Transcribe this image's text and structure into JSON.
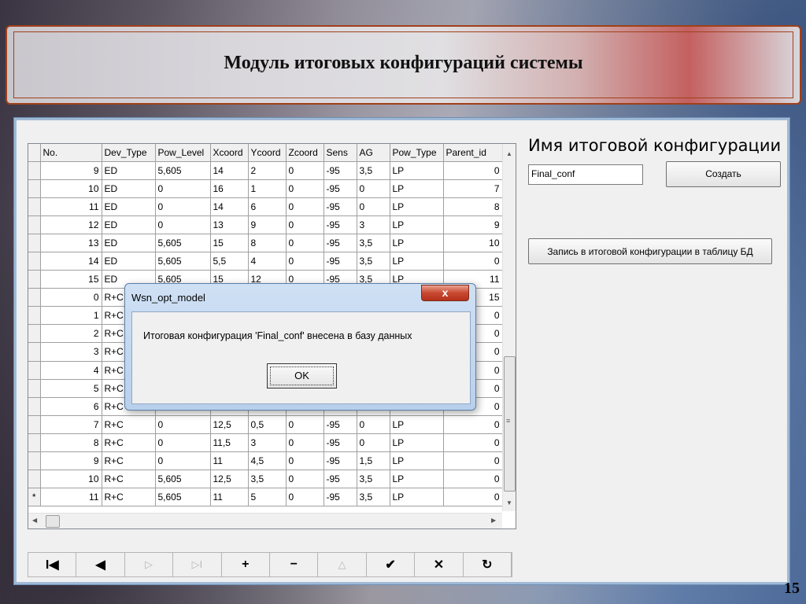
{
  "slide": {
    "title": "Модуль итоговых конфигураций системы",
    "page_number": "15"
  },
  "grid": {
    "columns": [
      "No.",
      "Dev_Type",
      "Pow_Level",
      "Xcoord",
      "Ycoord",
      "Zcoord",
      "Sens",
      "AG",
      "Pow_Type",
      "Parent_id"
    ],
    "rows": [
      {
        "ind": "",
        "no": "9",
        "dev": "ED",
        "pow": "5,605",
        "x": "14",
        "y": "2",
        "z": "0",
        "sens": "-95",
        "ag": "3,5",
        "ptype": "LP",
        "parent": "0"
      },
      {
        "ind": "",
        "no": "10",
        "dev": "ED",
        "pow": "0",
        "x": "16",
        "y": "1",
        "z": "0",
        "sens": "-95",
        "ag": "0",
        "ptype": "LP",
        "parent": "7"
      },
      {
        "ind": "",
        "no": "11",
        "dev": "ED",
        "pow": "0",
        "x": "14",
        "y": "6",
        "z": "0",
        "sens": "-95",
        "ag": "0",
        "ptype": "LP",
        "parent": "8"
      },
      {
        "ind": "",
        "no": "12",
        "dev": "ED",
        "pow": "0",
        "x": "13",
        "y": "9",
        "z": "0",
        "sens": "-95",
        "ag": "3",
        "ptype": "LP",
        "parent": "9"
      },
      {
        "ind": "",
        "no": "13",
        "dev": "ED",
        "pow": "5,605",
        "x": "15",
        "y": "8",
        "z": "0",
        "sens": "-95",
        "ag": "3,5",
        "ptype": "LP",
        "parent": "10"
      },
      {
        "ind": "",
        "no": "14",
        "dev": "ED",
        "pow": "5,605",
        "x": "5,5",
        "y": "4",
        "z": "0",
        "sens": "-95",
        "ag": "3,5",
        "ptype": "LP",
        "parent": "0"
      },
      {
        "ind": "",
        "no": "15",
        "dev": "ED",
        "pow": "5,605",
        "x": "15",
        "y": "12",
        "z": "0",
        "sens": "-95",
        "ag": "3,5",
        "ptype": "LP",
        "parent": "11"
      },
      {
        "ind": "",
        "no": "0",
        "dev": "R+C",
        "pow": "",
        "x": "",
        "y": "",
        "z": "",
        "sens": "",
        "ag": "",
        "ptype": "",
        "parent": "15"
      },
      {
        "ind": "",
        "no": "1",
        "dev": "R+C",
        "pow": "",
        "x": "",
        "y": "",
        "z": "",
        "sens": "",
        "ag": "",
        "ptype": "",
        "parent": "0"
      },
      {
        "ind": "",
        "no": "2",
        "dev": "R+C",
        "pow": "",
        "x": "",
        "y": "",
        "z": "",
        "sens": "",
        "ag": "",
        "ptype": "",
        "parent": "0"
      },
      {
        "ind": "",
        "no": "3",
        "dev": "R+C",
        "pow": "",
        "x": "",
        "y": "",
        "z": "",
        "sens": "",
        "ag": "",
        "ptype": "",
        "parent": "0"
      },
      {
        "ind": "",
        "no": "4",
        "dev": "R+C",
        "pow": "",
        "x": "",
        "y": "",
        "z": "",
        "sens": "",
        "ag": "",
        "ptype": "",
        "parent": "0"
      },
      {
        "ind": "",
        "no": "5",
        "dev": "R+C",
        "pow": "",
        "x": "",
        "y": "",
        "z": "",
        "sens": "",
        "ag": "",
        "ptype": "",
        "parent": "0"
      },
      {
        "ind": "",
        "no": "6",
        "dev": "R+C",
        "pow": "",
        "x": "",
        "y": "",
        "z": "",
        "sens": "",
        "ag": "",
        "ptype": "",
        "parent": "0"
      },
      {
        "ind": "",
        "no": "7",
        "dev": "R+C",
        "pow": "0",
        "x": "12,5",
        "y": "0,5",
        "z": "0",
        "sens": "-95",
        "ag": "0",
        "ptype": "LP",
        "parent": "0"
      },
      {
        "ind": "",
        "no": "8",
        "dev": "R+C",
        "pow": "0",
        "x": "11,5",
        "y": "3",
        "z": "0",
        "sens": "-95",
        "ag": "0",
        "ptype": "LP",
        "parent": "0"
      },
      {
        "ind": "",
        "no": "9",
        "dev": "R+C",
        "pow": "0",
        "x": "11",
        "y": "4,5",
        "z": "0",
        "sens": "-95",
        "ag": "1,5",
        "ptype": "LP",
        "parent": "0"
      },
      {
        "ind": "",
        "no": "10",
        "dev": "R+C",
        "pow": "5,605",
        "x": "12,5",
        "y": "3,5",
        "z": "0",
        "sens": "-95",
        "ag": "3,5",
        "ptype": "LP",
        "parent": "0"
      },
      {
        "ind": "*",
        "no": "11",
        "dev": "R+C",
        "pow": "5,605",
        "x": "11",
        "y": "5",
        "z": "0",
        "sens": "-95",
        "ag": "3,5",
        "ptype": "LP",
        "parent": "0"
      }
    ]
  },
  "navigator": {
    "buttons": [
      {
        "name": "nav-first-button",
        "glyph": "I◀",
        "enabled": true
      },
      {
        "name": "nav-prior-button",
        "glyph": "◀",
        "enabled": true
      },
      {
        "name": "nav-next-button",
        "glyph": "▷",
        "enabled": false
      },
      {
        "name": "nav-last-button",
        "glyph": "▷I",
        "enabled": false
      },
      {
        "name": "nav-insert-button",
        "glyph": "+",
        "enabled": true
      },
      {
        "name": "nav-delete-button",
        "glyph": "−",
        "enabled": true
      },
      {
        "name": "nav-edit-button",
        "glyph": "△",
        "enabled": false
      },
      {
        "name": "nav-post-button",
        "glyph": "✔",
        "enabled": true
      },
      {
        "name": "nav-cancel-button",
        "glyph": "✕",
        "enabled": true
      },
      {
        "name": "nav-refresh-button",
        "glyph": "↻",
        "enabled": true
      }
    ]
  },
  "panel": {
    "title": "Имя итоговой конфигурации",
    "name_value": "Final_conf",
    "create_label": "Создать",
    "save_label": "Запись в итоговой конфигурации в таблицу БД"
  },
  "dialog": {
    "title": "Wsn_opt_model",
    "close_glyph": "x",
    "message": "Итоговая конфигурация 'Final_conf'  внесена в базу данных",
    "ok_label": "OK"
  },
  "colors": {
    "banner_border": "#a0401a",
    "window_border": "#9fb9d6",
    "close_button": "#c8482f"
  }
}
